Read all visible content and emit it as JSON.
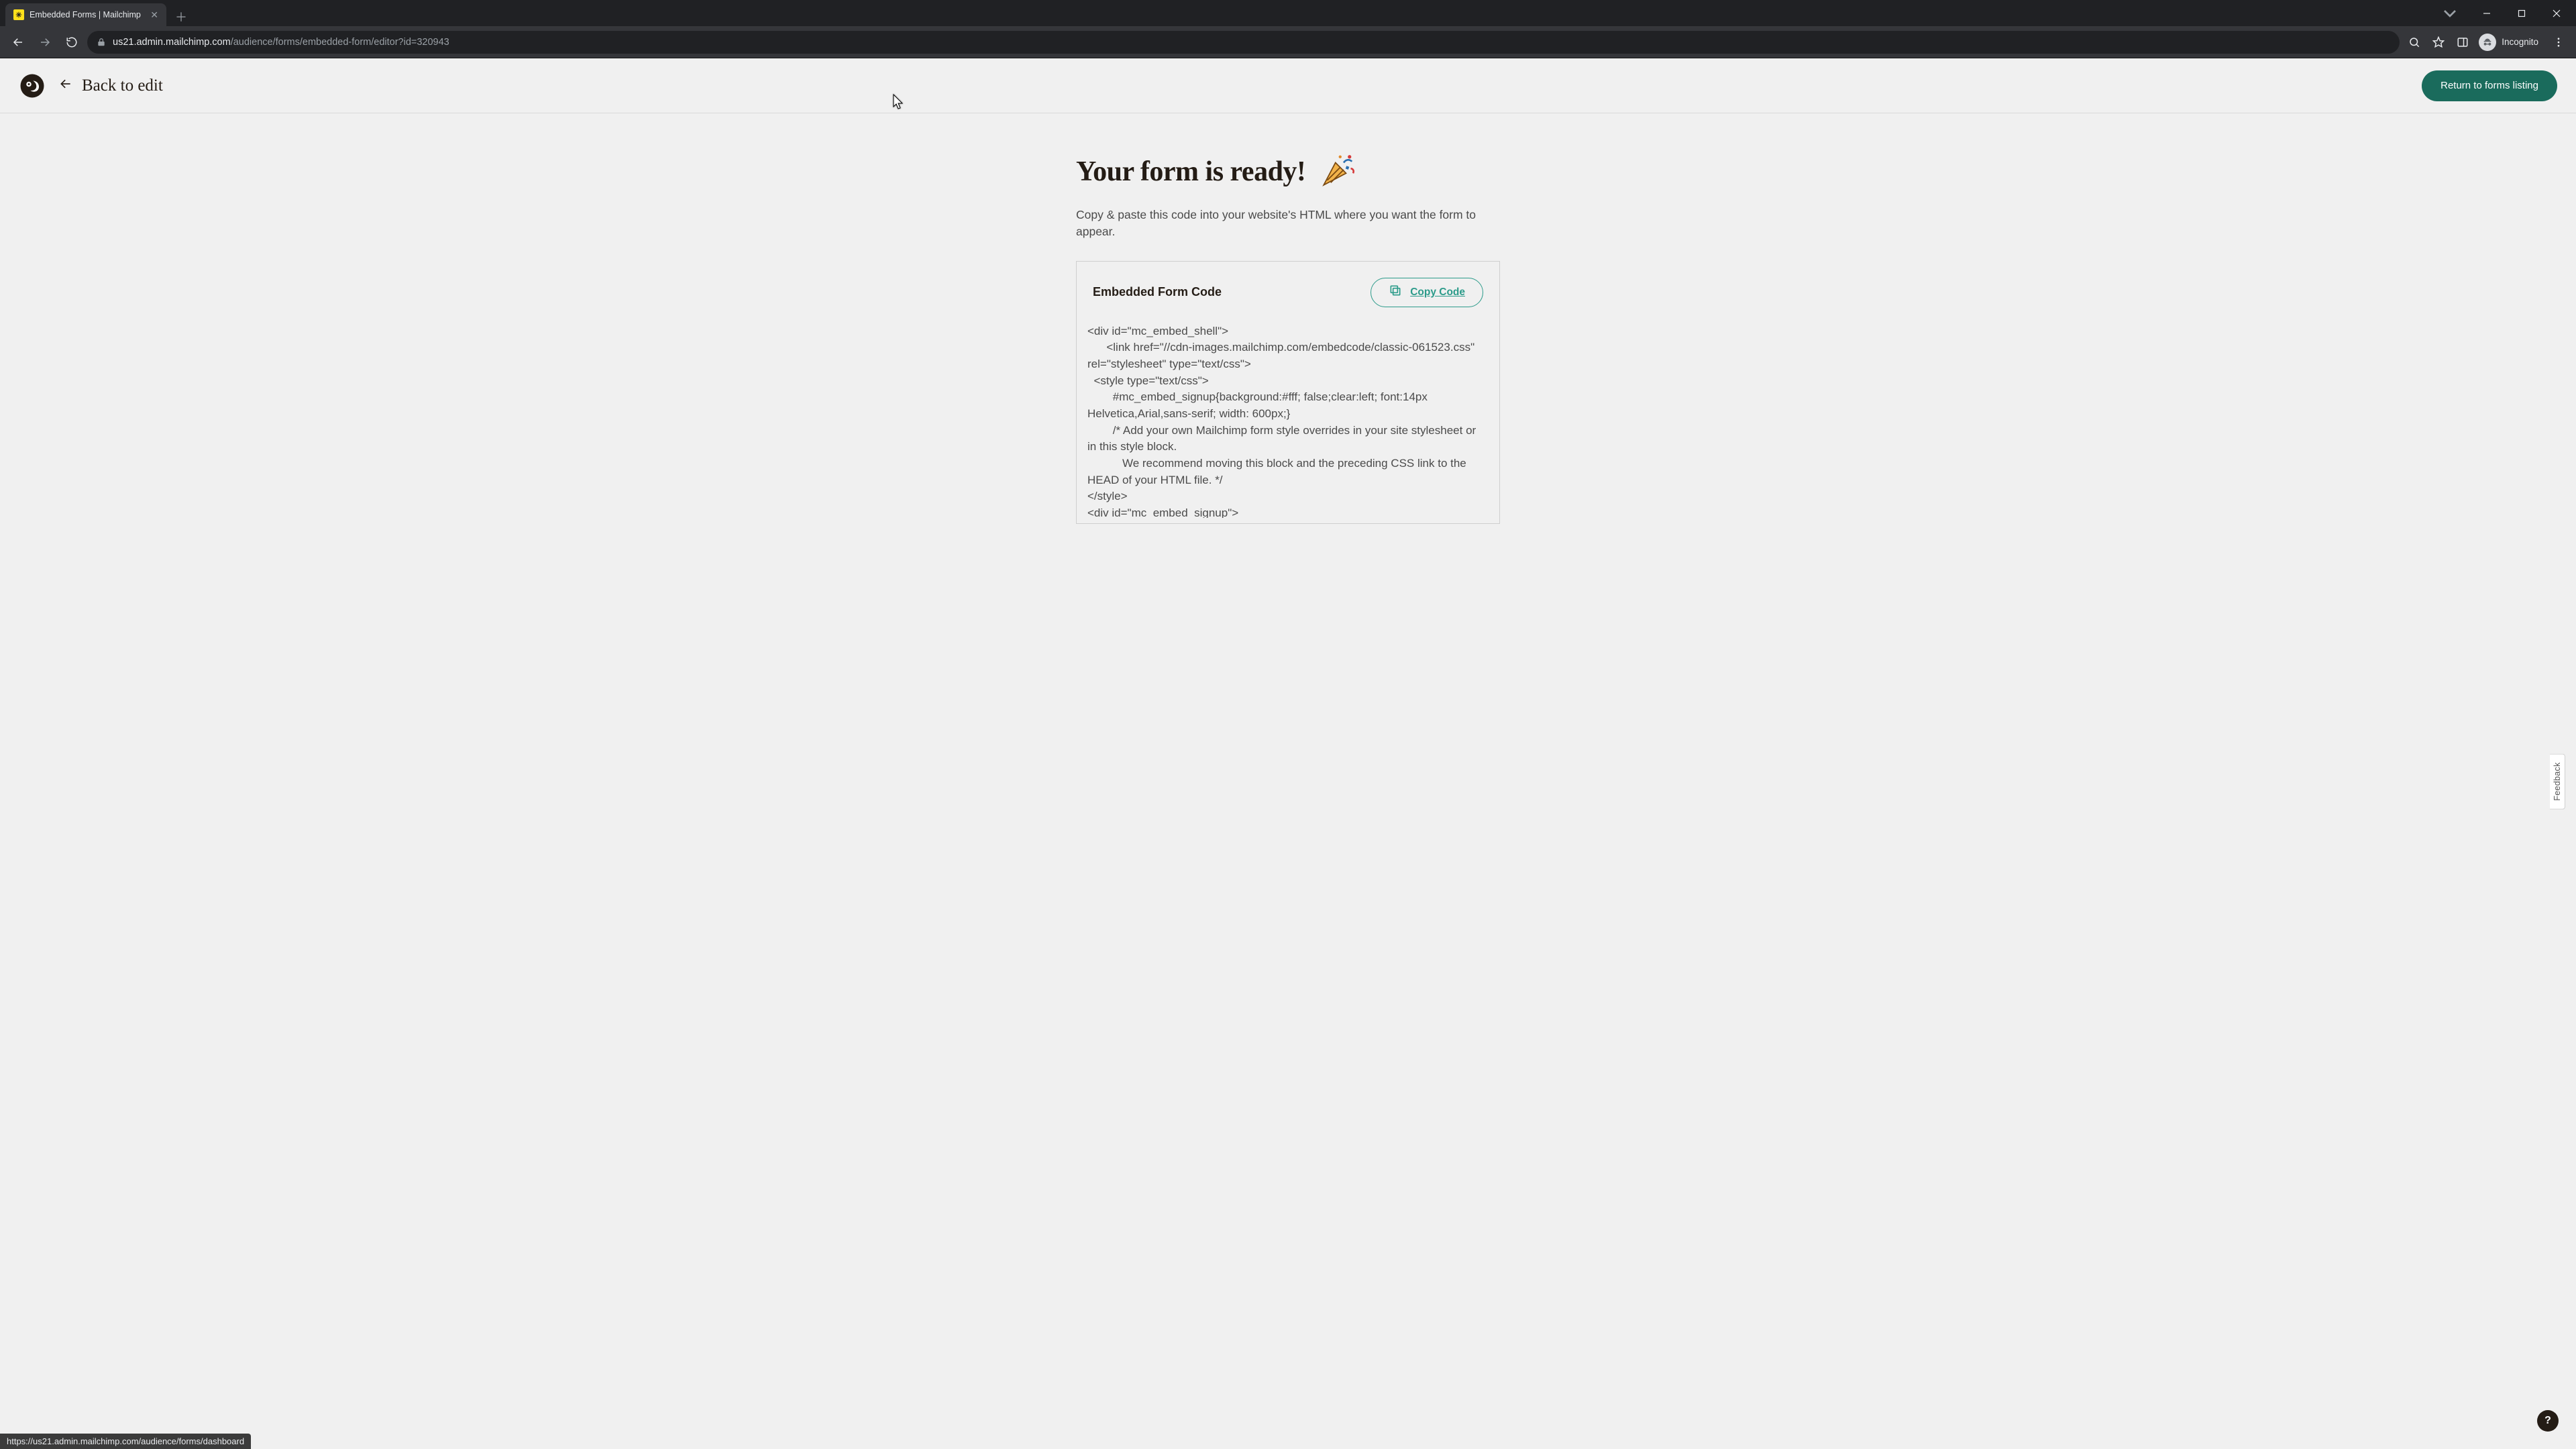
{
  "browser": {
    "tab_title": "Embedded Forms | Mailchimp",
    "url_host": "us21.admin.mailchimp.com",
    "url_path": "/audience/forms/embedded-form/editor?id=320943",
    "incognito_label": "Incognito"
  },
  "header": {
    "back_label": "Back to edit",
    "return_button": "Return to forms listing"
  },
  "hero": {
    "title": "Your form is ready!",
    "subtitle": "Copy & paste this code into your website's HTML where you want the form to appear."
  },
  "code_card": {
    "title": "Embedded Form Code",
    "copy_label": "Copy Code",
    "code": "<div id=\"mc_embed_shell\">\n      <link href=\"//cdn-images.mailchimp.com/embedcode/classic-061523.css\" rel=\"stylesheet\" type=\"text/css\">\n  <style type=\"text/css\">\n        #mc_embed_signup{background:#fff; false;clear:left; font:14px Helvetica,Arial,sans-serif; width: 600px;}\n        /* Add your own Mailchimp form style overrides in your site stylesheet or in this style block.\n           We recommend moving this block and the preceding CSS link to the HEAD of your HTML file. */\n</style>\n<div id=\"mc_embed_signup\">"
  },
  "feedback_tab": "Feedback",
  "help_bubble": "?",
  "status_bar": "https://us21.admin.mailchimp.com/audience/forms/dashboard"
}
